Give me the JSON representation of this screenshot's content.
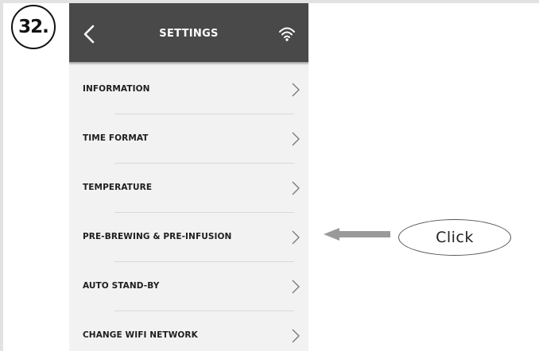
{
  "step": {
    "number": "32."
  },
  "header": {
    "title": "SETTINGS",
    "back_icon": "chevron-left-icon",
    "wifi_icon": "wifi-icon",
    "bg": "#494949"
  },
  "menu": {
    "items": [
      {
        "label": "INFORMATION"
      },
      {
        "label": "TIME FORMAT"
      },
      {
        "label": "TEMPERATURE"
      },
      {
        "label": "PRE-BREWING & PRE-INFUSION"
      },
      {
        "label": "AUTO STAND-BY"
      },
      {
        "label": "CHANGE WIFI NETWORK"
      }
    ],
    "chevron_icon": "chevron-right-icon"
  },
  "callout": {
    "text": "Click",
    "arrow_icon": "arrow-left-icon",
    "arrow_color": "#9a9a9a"
  }
}
